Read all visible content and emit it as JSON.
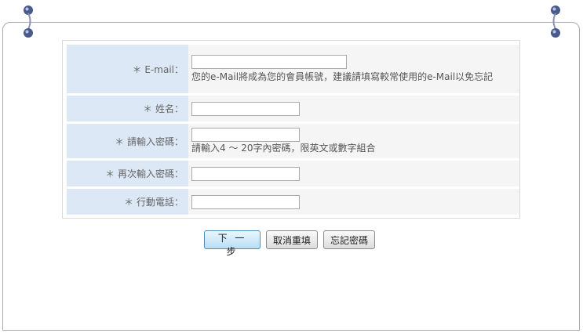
{
  "form": {
    "rows": [
      {
        "label": "＊ E-mail：",
        "note": "您的e-Mail將成為您的會員帳號，建議請填寫較常使用的e-Mail以免忘記"
      },
      {
        "label": "＊ 姓名：",
        "note": ""
      },
      {
        "label": "＊ 請輸入密碼：",
        "note": "請輸入4 ～ 20字內密碼，限英文或數字組合"
      },
      {
        "label": "＊ 再次輸入密碼：",
        "note": ""
      },
      {
        "label": "＊ 行動電話：",
        "note": ""
      }
    ]
  },
  "buttons": {
    "next": "下 一 步",
    "reset": "取消重填",
    "forgot": "忘記密碼"
  },
  "colors": {
    "label_bg": "#dce8f5",
    "field_bg": "#f5f5f5",
    "primary_button": "#b8def5"
  }
}
